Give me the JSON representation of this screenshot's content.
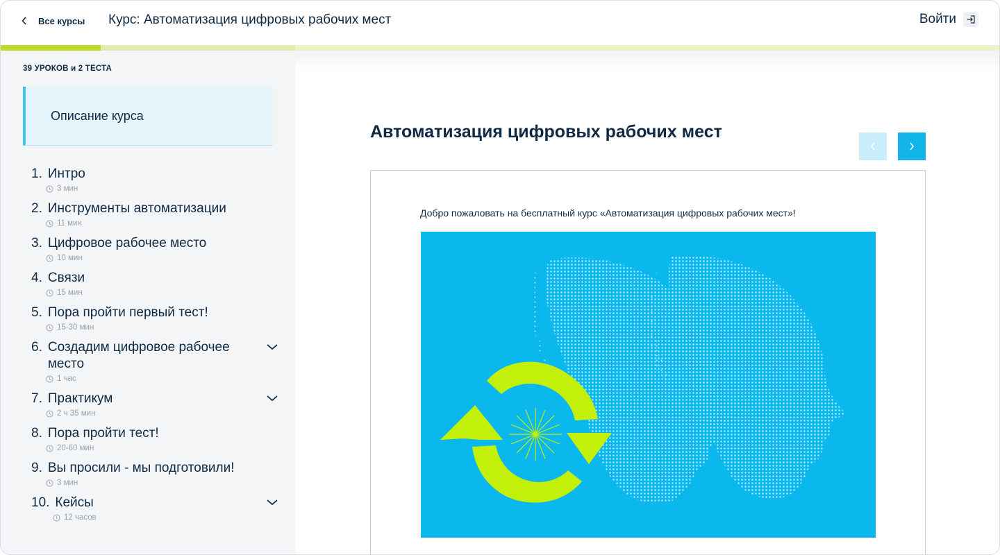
{
  "header": {
    "back_label": "Все курсы",
    "course_title": "Курс: Автоматизация цифровых рабочих мест",
    "login_label": "Войти"
  },
  "progress": {
    "fraction": 0.1
  },
  "sidebar": {
    "counter": "39 УРОКОВ и 2 ТЕСТА",
    "description_label": "Описание курса",
    "lessons": [
      {
        "num": "1.",
        "title": "Интро",
        "duration": "3 мин",
        "expandable": false
      },
      {
        "num": "2.",
        "title": "Инструменты автоматизации",
        "duration": "11 мин",
        "expandable": false
      },
      {
        "num": "3.",
        "title": "Цифровое рабочее место",
        "duration": "10 мин",
        "expandable": false
      },
      {
        "num": "4.",
        "title": "Связи",
        "duration": "15 мин",
        "expandable": false
      },
      {
        "num": "5.",
        "title": "Пора пройти первый тест!",
        "duration": "15-30 мин",
        "expandable": false
      },
      {
        "num": "6.",
        "title": "Создадим цифровое рабочее место",
        "duration": "1 час",
        "expandable": true
      },
      {
        "num": "7.",
        "title": "Практикум",
        "duration": "2 ч 35 мин",
        "expandable": true
      },
      {
        "num": "8.",
        "title": "Пора пройти тест!",
        "duration": "20-60 мин",
        "expandable": false
      },
      {
        "num": "9.",
        "title": "Вы просили - мы подготовили!",
        "duration": "3 мин",
        "expandable": false
      },
      {
        "num": "10.",
        "title": "Кейсы",
        "duration": "12 часов",
        "expandable": true
      }
    ]
  },
  "main": {
    "page_title": "Автоматизация цифровых рабочих мест",
    "welcome_text": "Добро пожаловать на бесплатный курс «Автоматизация цифровых рабочих мест»!"
  },
  "colors": {
    "accent": "#12b5ea",
    "accent_light": "#c7eefa",
    "progress": "#bedc2e",
    "hero_bg": "#0ab8ee",
    "arrows": "#c2f00a",
    "text": "#0f2a44"
  },
  "icons": {
    "back": "chevron-left-icon",
    "login": "login-icon",
    "clock": "clock-icon",
    "expand": "chevron-down-icon",
    "prev": "chevron-left-icon",
    "next": "chevron-right-icon"
  }
}
